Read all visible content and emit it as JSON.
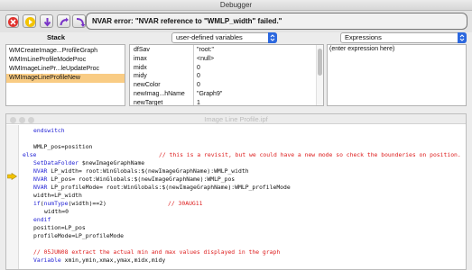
{
  "window": {
    "title": "Debugger"
  },
  "toolbar": {
    "message": "NVAR error: \"NVAR reference to \"WMLP_width\" failed.\""
  },
  "stack": {
    "label": "Stack",
    "items": [
      "WMCreateImage...ProfileGraph",
      "WMImLineProfileModeProc",
      "WMImageLinePr...leUpdateProc",
      "WMImageLineProfileNew"
    ],
    "selected_index": 3
  },
  "variables": {
    "popup_value": "user-defined variables",
    "rows": [
      {
        "name": "dfSav",
        "value": "\"root:\""
      },
      {
        "name": "imax",
        "value": "<null>"
      },
      {
        "name": "midx",
        "value": "0"
      },
      {
        "name": "midy",
        "value": "0"
      },
      {
        "name": "newColor",
        "value": "0"
      },
      {
        "name": "newImag...hName",
        "value": "\"Graph9\""
      },
      {
        "name": "newTarget",
        "value": "1"
      }
    ]
  },
  "expressions": {
    "popup_value": "Expressions",
    "placeholder": "(enter expression here)"
  },
  "procedure": {
    "title": "Image Line Profile.ipf",
    "lines": [
      {
        "text": "endswitch"
      },
      {
        "text": ""
      },
      {
        "text": "WMLP_pos=position"
      },
      {
        "text": "else",
        "comment": "// this is a revisit, but we could have a new mode so check the bounderies on position."
      },
      {
        "text": "SetDataFolder $newImageGraphName"
      },
      {
        "text": "NVAR LP_width= root:WinGlobals:$(newImageGraphName):WMLP_width"
      },
      {
        "text": "NVAR LP_pos= root:WinGlobals:$(newImageGraphName):WMLP_pos"
      },
      {
        "text": "NVAR LP_profileMode= root:WinGlobals:$(newImageGraphName):WMLP_profileMode"
      },
      {
        "text": "width=LP_width"
      },
      {
        "text": "if(numType(width)==2)",
        "comment": "// 30AUG11"
      },
      {
        "text": "width=0"
      },
      {
        "text": "endif"
      },
      {
        "text": "position=LP_pos"
      },
      {
        "text": "profileMode=LP_profileMode"
      },
      {
        "text": ""
      },
      {
        "text": "",
        "comment": "// 05JUN08 extract the actual min and max values displayed in the graph"
      },
      {
        "text": "Variable xmin,ymin,xmax,ymax,midx,midy"
      }
    ]
  },
  "colors": {
    "keyword": "#1f1fd4",
    "comment": "#dd1c1c",
    "selection": "#f9cc84",
    "pointer": "#f2c200"
  }
}
